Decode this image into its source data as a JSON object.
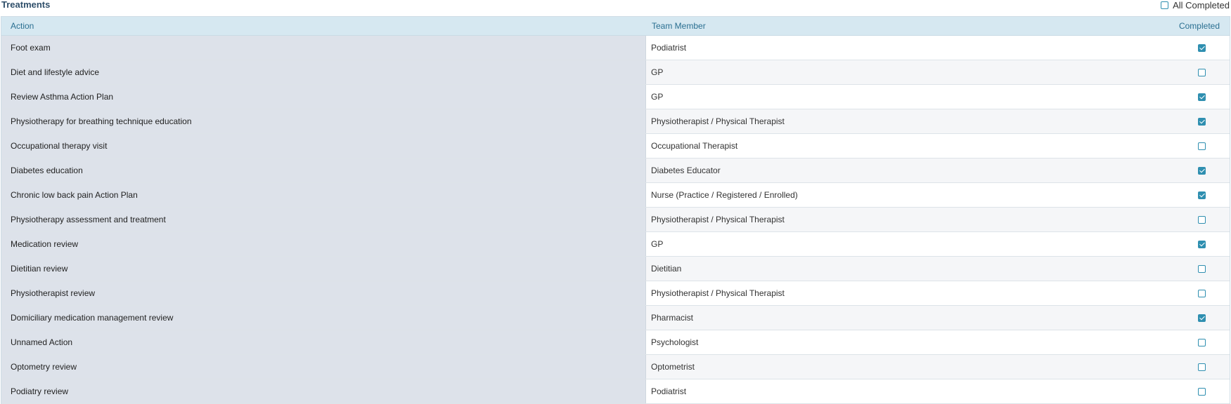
{
  "title": "Treatments",
  "all_completed": {
    "label": "All Completed",
    "checked": false
  },
  "columns": {
    "action": "Action",
    "team_member": "Team Member",
    "completed": "Completed"
  },
  "accent_color": "#2f8fb0",
  "rows": [
    {
      "action": "Foot exam",
      "team_member": "Podiatrist",
      "completed": true
    },
    {
      "action": "Diet and lifestyle advice",
      "team_member": "GP",
      "completed": false
    },
    {
      "action": "Review Asthma Action Plan",
      "team_member": "GP",
      "completed": true
    },
    {
      "action": "Physiotherapy for breathing technique education",
      "team_member": "Physiotherapist / Physical Therapist",
      "completed": true
    },
    {
      "action": "Occupational therapy visit",
      "team_member": "Occupational Therapist",
      "completed": false
    },
    {
      "action": "Diabetes education",
      "team_member": "Diabetes Educator",
      "completed": true
    },
    {
      "action": "Chronic low back pain Action Plan",
      "team_member": "Nurse (Practice / Registered / Enrolled)",
      "completed": true
    },
    {
      "action": "Physiotherapy assessment and treatment",
      "team_member": "Physiotherapist / Physical Therapist",
      "completed": false
    },
    {
      "action": "Medication review",
      "team_member": "GP",
      "completed": true
    },
    {
      "action": "Dietitian review",
      "team_member": "Dietitian",
      "completed": false
    },
    {
      "action": "Physiotherapist review",
      "team_member": "Physiotherapist / Physical Therapist",
      "completed": false
    },
    {
      "action": "Domiciliary medication management review",
      "team_member": "Pharmacist",
      "completed": true
    },
    {
      "action": "Unnamed Action",
      "team_member": "Psychologist",
      "completed": false
    },
    {
      "action": "Optometry review",
      "team_member": "Optometrist",
      "completed": false
    },
    {
      "action": "Podiatry review",
      "team_member": "Podiatrist",
      "completed": false
    }
  ]
}
